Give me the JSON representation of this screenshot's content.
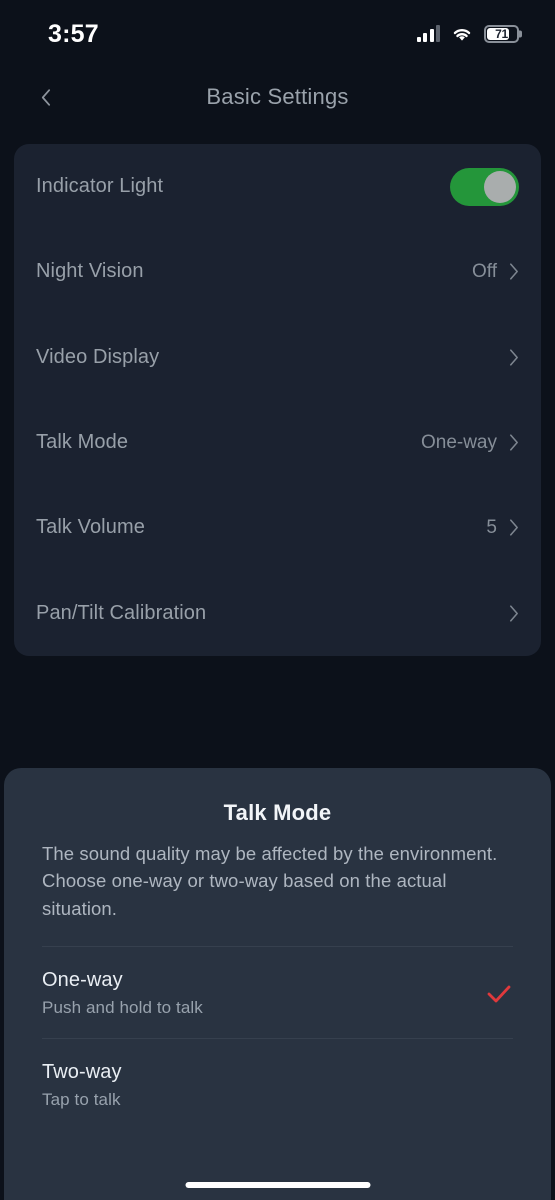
{
  "status_bar": {
    "time": "3:57",
    "battery_percent": "71",
    "battery_level": 71,
    "cellular_icon": "cellular-signal-icon",
    "wifi_icon": "wifi-icon",
    "battery_icon": "battery-icon"
  },
  "nav": {
    "title": "Basic Settings",
    "back_icon": "chevron-left-icon"
  },
  "settings": {
    "rows": [
      {
        "label": "Indicator Light",
        "control": "toggle",
        "value": "",
        "toggle_on": true
      },
      {
        "label": "Night Vision",
        "control": "value-chevron",
        "value": "Off"
      },
      {
        "label": "Video Display",
        "control": "chevron",
        "value": ""
      },
      {
        "label": "Talk Mode",
        "control": "value-chevron",
        "value": "One-way"
      },
      {
        "label": "Talk Volume",
        "control": "value-chevron",
        "value": "5"
      },
      {
        "label": "Pan/Tilt Calibration",
        "control": "chevron",
        "value": ""
      }
    ]
  },
  "sheet": {
    "title": "Talk Mode",
    "description": "The sound quality may be affected by the environment. Choose one-way or two-way based on the actual situation.",
    "options": [
      {
        "title": "One-way",
        "subtitle": "Push and hold to talk",
        "selected": true
      },
      {
        "title": "Two-way",
        "subtitle": "Tap to talk",
        "selected": false
      }
    ]
  },
  "colors": {
    "page_background": "#0c111a",
    "card_background": "#1b2230",
    "sheet_background": "#293341",
    "toggle_on": "#24963a",
    "toggle_knob": "#a9adad",
    "check_red": "#e0393c",
    "label_gray": "#98a0a9",
    "title_white": "#f2f5f8"
  }
}
